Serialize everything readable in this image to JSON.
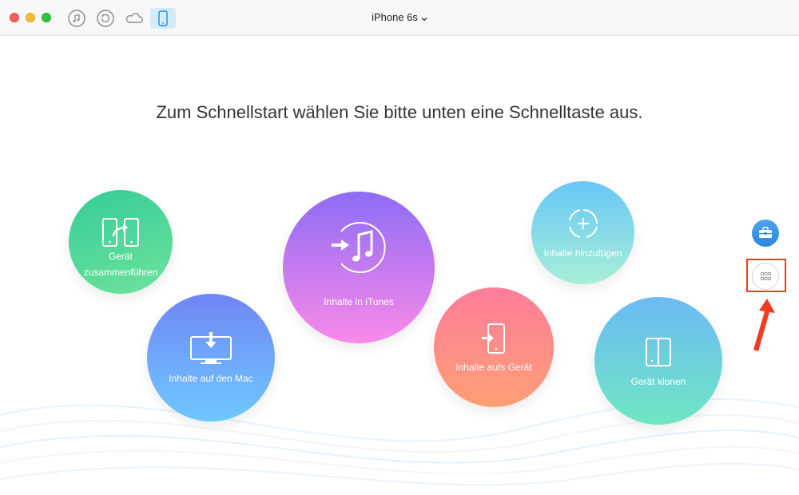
{
  "window": {
    "device_title": "iPhone 6s"
  },
  "toolbar": {
    "icons": [
      "music-icon",
      "restore-icon",
      "cloud-icon",
      "device-icon"
    ]
  },
  "main": {
    "headline": "Zum Schnellstart wählen Sie bitte unten eine Schnelltaste aus.",
    "shortcuts": [
      {
        "id": "merge",
        "label_line1": "Gerät",
        "label_line2": "zusammenführen",
        "icon": "merge-devices-icon"
      },
      {
        "id": "mac",
        "label": "Inhalte auf den Mac",
        "icon": "download-to-mac-icon"
      },
      {
        "id": "itunes",
        "label": "Inhalte in iTunes",
        "icon": "itunes-note-icon"
      },
      {
        "id": "device",
        "label": "Inhalte aufs Gerät",
        "icon": "transfer-to-device-icon"
      },
      {
        "id": "add",
        "label": "Inhalte hinzufügen",
        "icon": "add-content-icon"
      },
      {
        "id": "clone",
        "label": "Gerät klonen",
        "icon": "clone-device-icon"
      }
    ]
  },
  "side": {
    "toolbox_icon": "toolbox-icon",
    "apps_icon": "apps-grid-icon"
  },
  "colors": {
    "highlight": "#f23a1f",
    "accent": "#2b86e0"
  }
}
